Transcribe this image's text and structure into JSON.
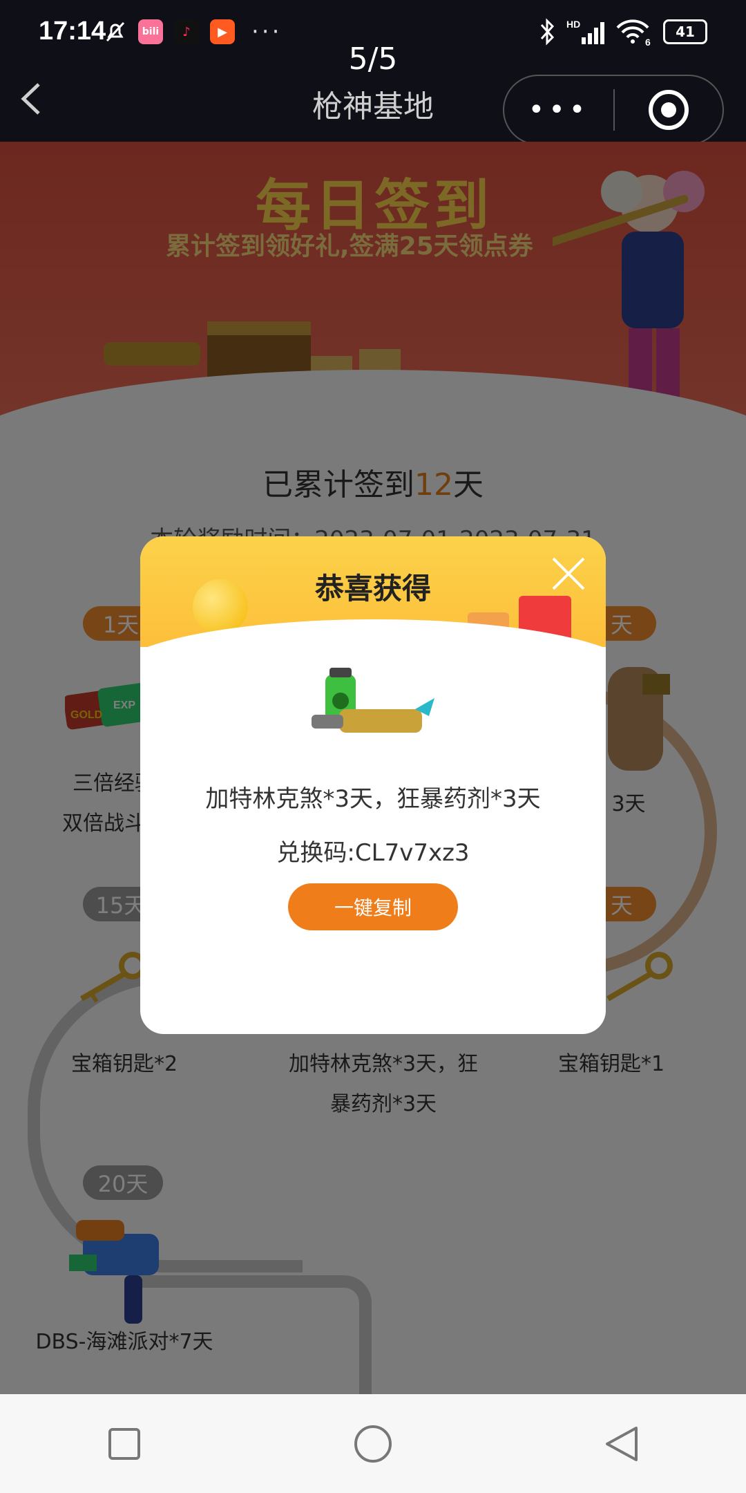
{
  "status_bar": {
    "time": "17:14",
    "apps": [
      {
        "name": "bilibili",
        "text": "bili",
        "color": "#fb7299"
      },
      {
        "name": "douyin",
        "text": "♪",
        "color": "#111111"
      },
      {
        "name": "kuaishou",
        "text": "▶",
        "color": "#ff5a1f"
      }
    ],
    "more": "···",
    "network": "HD",
    "wifi_num": "6",
    "battery": "41"
  },
  "nav": {
    "page_indicator": "5/5",
    "title": "枪神基地",
    "more_label": "•••"
  },
  "banner": {
    "title": "每日签到",
    "subtitle": "累计签到领好礼,签满25天领点券"
  },
  "summary": {
    "prefix": "已累计签到",
    "days": "12",
    "suffix": "天",
    "period": "本轮奖励时间：2023-07-01-2023-07-31"
  },
  "rewards": [
    {
      "badge": "1天",
      "label_line1": "三倍经验卡",
      "label_line2": "双倍战斗金币"
    },
    {
      "badge": "天",
      "label": "3天"
    },
    {
      "badge": "15天",
      "label": "宝箱钥匙*2"
    },
    {
      "label_line1": "加特林克煞*3天，狂",
      "label_line2": "暴药剂*3天"
    },
    {
      "badge": "天",
      "label": "宝箱钥匙*1"
    },
    {
      "badge": "20天",
      "label": "DBS-海滩派对*7天"
    }
  ],
  "modal": {
    "title": "恭喜获得",
    "description": "加特林克煞*3天，狂暴药剂*3天",
    "code_prefix": "兑换码:",
    "code": "CL7v7xz3",
    "copy_button": "一键复制"
  },
  "colors": {
    "accent": "#ef7e1a",
    "banner_red": "#d9503f",
    "modal_yellow": "#fcd24a"
  }
}
